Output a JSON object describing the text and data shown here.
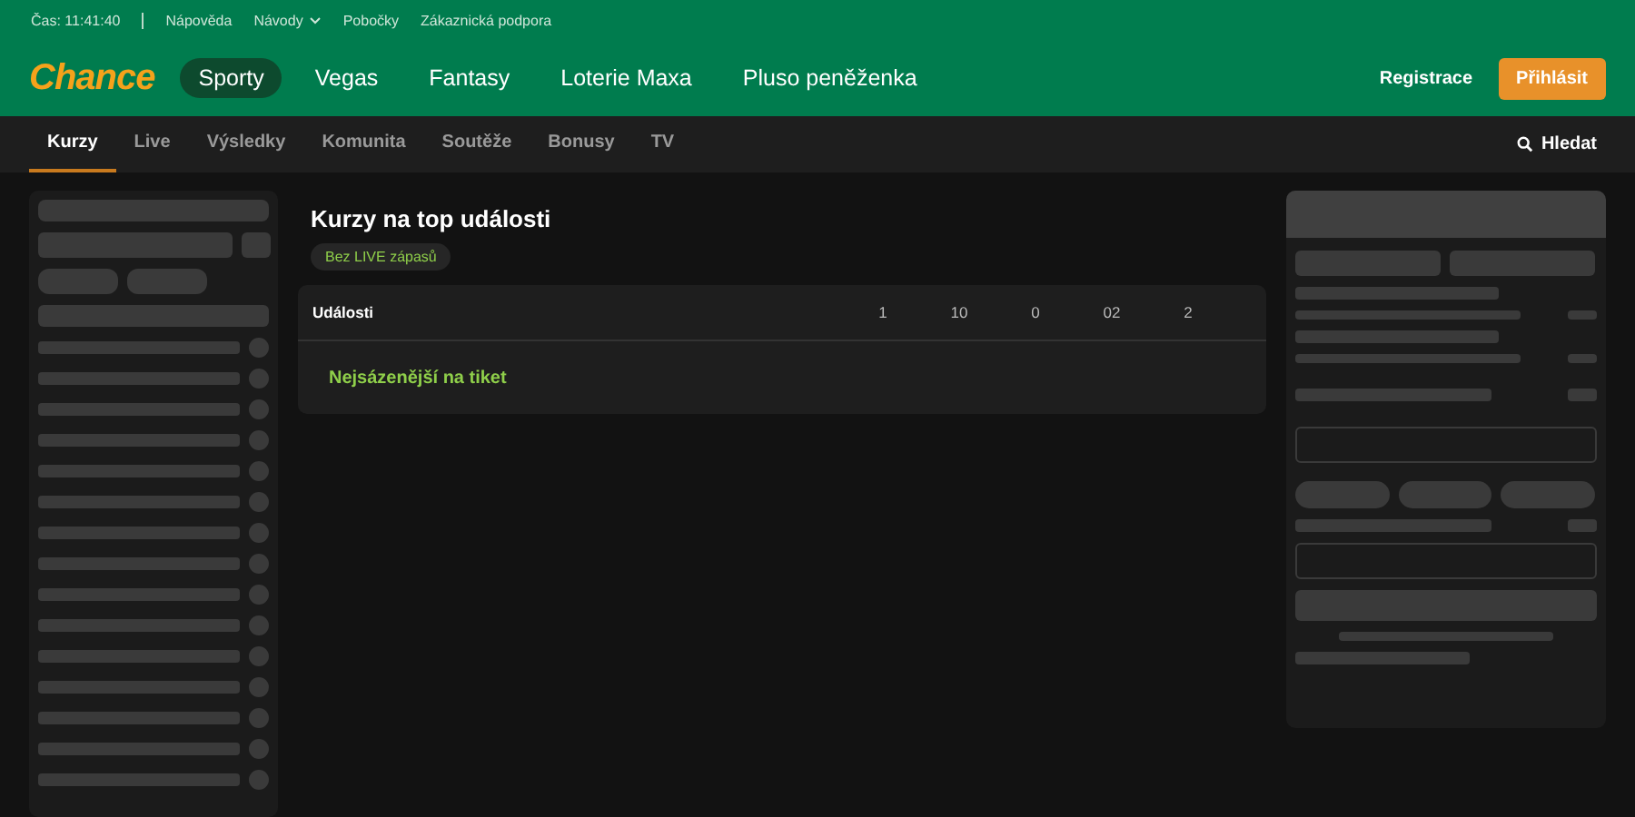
{
  "top_bar": {
    "time": "Čas: 11:41:40",
    "links": [
      {
        "label": "Nápověda",
        "dropdown": false
      },
      {
        "label": "Návody",
        "dropdown": true
      },
      {
        "label": "Pobočky",
        "dropdown": false
      },
      {
        "label": "Zákaznická podpora",
        "dropdown": false
      }
    ]
  },
  "header": {
    "logo": "Chance",
    "nav": [
      {
        "label": "Sporty",
        "selected": true
      },
      {
        "label": "Vegas",
        "selected": false
      },
      {
        "label": "Fantasy",
        "selected": false
      },
      {
        "label": "Loterie Maxa",
        "selected": false
      },
      {
        "label": "Pluso peněženka",
        "selected": false
      }
    ],
    "register": "Registrace",
    "login": "Přihlásit"
  },
  "subnav": {
    "tabs": [
      {
        "label": "Kurzy",
        "selected": true
      },
      {
        "label": "Live",
        "selected": false
      },
      {
        "label": "Výsledky",
        "selected": false
      },
      {
        "label": "Komunita",
        "selected": false
      },
      {
        "label": "Soutěže",
        "selected": false
      },
      {
        "label": "Bonusy",
        "selected": false
      },
      {
        "label": "TV",
        "selected": false
      }
    ],
    "search": "Hledat"
  },
  "main": {
    "title": "Kurzy na top události",
    "filter": "Bez LIVE zápasů",
    "table": {
      "columns": [
        "Události",
        "1",
        "10",
        "0",
        "02",
        "2"
      ],
      "section": "Nejsázenější na tiket"
    }
  }
}
